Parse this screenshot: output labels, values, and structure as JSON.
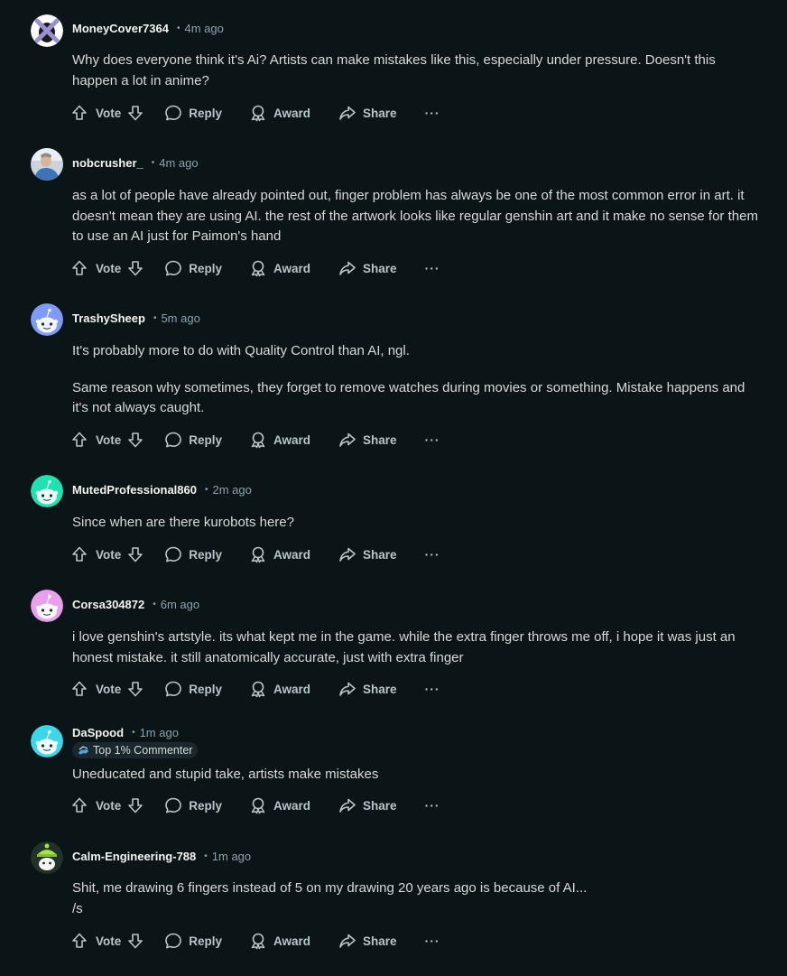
{
  "actions": {
    "vote": "Vote",
    "reply": "Reply",
    "award": "Award",
    "share": "Share",
    "more": "···"
  },
  "comments": [
    {
      "username": "MoneyCover7364",
      "time": "4m ago",
      "avatar": "crossed-avatar",
      "paragraphs": [
        "Why does everyone think it's Ai? Artists can make mistakes like this, especially under pressure. Doesn't this happen a lot in anime?"
      ]
    },
    {
      "username": "nobcrusher_",
      "time": "4m ago",
      "avatar": "photo-avatar",
      "paragraphs": [
        "as a lot of people have already pointed out, finger problem has always be one of the most common error in art. it doesn't mean they are using AI. the rest of the artwork looks like regular genshin art and it make no sense for them to use an AI just for Paimon's hand"
      ]
    },
    {
      "username": "TrashySheep",
      "time": "5m ago",
      "avatar": "snoo-avatar-blue",
      "avatar_color": "#7e9cf5",
      "paragraphs": [
        "It's probably more to do with Quality Control than AI, ngl.",
        "Same reason why sometimes, they forget to remove watches during movies or something. Mistake happens and it's not always caught."
      ]
    },
    {
      "username": "MutedProfessional860",
      "time": "2m ago",
      "avatar": "snoo-avatar-teal",
      "avatar_color": "#1ee3b1",
      "paragraphs": [
        "Since when are there kurobots here?"
      ]
    },
    {
      "username": "Corsa304872",
      "time": "6m ago",
      "avatar": "snoo-avatar-pink",
      "avatar_color": "#e8a0ec",
      "paragraphs": [
        "i love genshin's artstyle. its what kept me in the game. while the extra finger throws me off, i hope it was just an honest mistake. it still anatomically accurate, just with extra finger"
      ]
    },
    {
      "username": "DaSpood",
      "time": "1m ago",
      "avatar": "snoo-avatar-cyan",
      "avatar_color": "#3dd6e8",
      "flair": "Top 1% Commenter",
      "paragraphs": [
        "Uneducated and stupid take, artists make mistakes"
      ]
    },
    {
      "username": "Calm-Engineering-788",
      "time": "1m ago",
      "avatar": "snoo-avatar-green",
      "avatar_color": "#a6e34b",
      "paragraphs": [
        "Shit, me drawing 6 fingers instead of 5 on my drawing 20 years ago is because of AI...",
        "/s"
      ]
    }
  ]
}
